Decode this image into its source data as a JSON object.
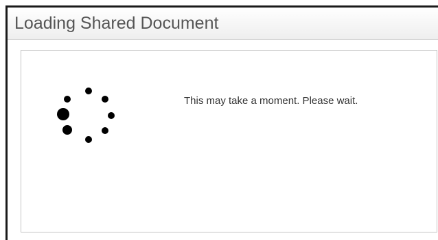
{
  "dialog": {
    "title": "Loading Shared Document",
    "message": "This may take a moment. Please wait."
  },
  "spinner": {
    "icon": "loading-spinner-icon",
    "dot_count": 8
  },
  "colors": {
    "title_text": "#555555",
    "message_text": "#333333",
    "panel_border": "#c4c4c4",
    "spinner_dot": "#000000"
  }
}
